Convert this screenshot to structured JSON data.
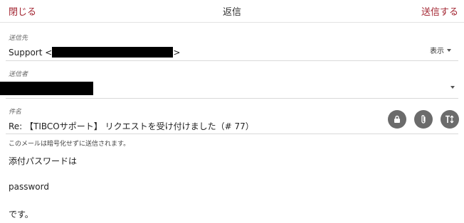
{
  "header": {
    "close_label": "閉じる",
    "title": "返信",
    "send_label": "送信する"
  },
  "to": {
    "label": "送信先",
    "value_prefix": "Support <",
    "value_suffix": ">",
    "show_label": "表示"
  },
  "from": {
    "label": "送信者"
  },
  "subject": {
    "label": "件名",
    "value": "Re: 【TIBCOサポート】 リクエストを受け付けました（# 77）"
  },
  "encryption_note": "このメールは暗号化せずに送信されます。",
  "body_lines": [
    "添付パスワードは",
    "password",
    "です。"
  ],
  "icons": {
    "lock": "lock-icon",
    "attach": "paperclip-icon",
    "format": "text-format-icon"
  },
  "colors": {
    "accent": "#a32632",
    "icon_button": "#6b6b6b"
  }
}
